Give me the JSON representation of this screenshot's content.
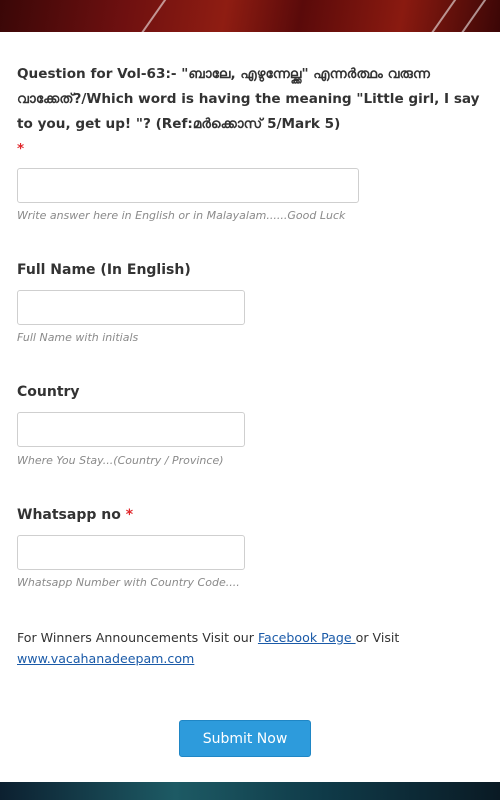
{
  "form": {
    "question": {
      "label": "Question for Vol-63:- \"ബാലേ, എഴുന്നേല്ക്ക\" എന്നർത്ഥം വരുന്ന വാക്കേത്?/Which word is having the meaning \"Little girl, I say to you, get up! \"? (Ref:മർക്കൊസ് 5/Mark 5)",
      "required_mark": "*",
      "value": "",
      "hint": "Write answer here in English or in Malayalam......Good Luck"
    },
    "full_name": {
      "label": "Full Name (In English)",
      "value": "",
      "hint": "Full Name with initials"
    },
    "country": {
      "label": "Country",
      "value": "",
      "hint": "Where You Stay...(Country / Province)"
    },
    "whatsapp": {
      "label": "Whatsapp no",
      "required_mark": "*",
      "value": "",
      "hint": "Whatsapp Number with Country Code...."
    },
    "info": {
      "prefix": "For Winners Announcements Visit our ",
      "facebook_link": "Facebook Page ",
      "middle": "or Visit",
      "site_link": "www.vacahanadeepam.com"
    },
    "submit_label": "Submit Now"
  },
  "colors": {
    "required": "#e0262b",
    "link": "#1a5aa8",
    "button": "#2d9bdc",
    "top_banner": "#6e1010",
    "bottom_banner": "#1d5a64"
  }
}
